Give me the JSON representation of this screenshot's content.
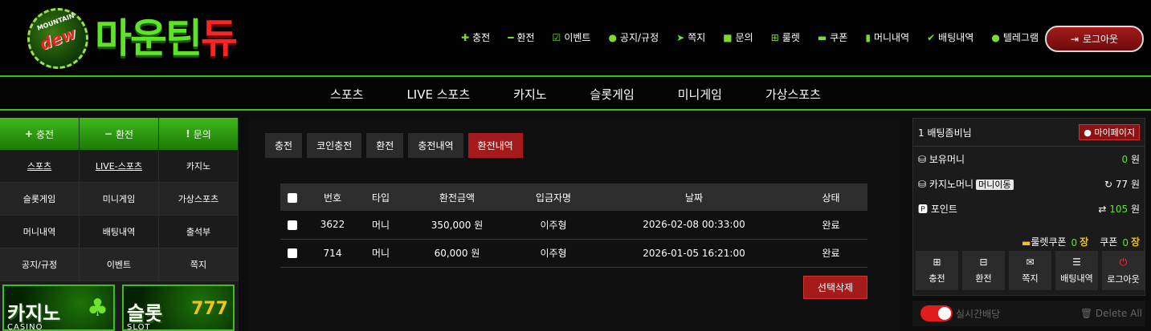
{
  "brand": {
    "logo_text": "마운틴",
    "logo_text_red": "듀",
    "cap_top": "MOUNTAIN",
    "cap_main": "dew"
  },
  "topnav": [
    {
      "icon": "plus",
      "label": "충전"
    },
    {
      "icon": "minus",
      "label": "환전"
    },
    {
      "icon": "calendar-check",
      "label": "이벤트"
    },
    {
      "icon": "info-circle",
      "label": "공지/규정"
    },
    {
      "icon": "paper-plane",
      "label": "쪽지"
    },
    {
      "icon": "edit",
      "label": "문의"
    },
    {
      "icon": "gift",
      "label": "룰렛"
    },
    {
      "icon": "ticket",
      "label": "쿠폰"
    },
    {
      "icon": "clipboard",
      "label": "머니내역"
    },
    {
      "icon": "check",
      "label": "배팅내역"
    },
    {
      "icon": "telegram",
      "label": "텔레그램"
    }
  ],
  "logout_label": "로그아웃",
  "mainnav": [
    "스포츠",
    "LIVE 스포츠",
    "카지노",
    "슬롯게임",
    "미니게임",
    "가상스포츠"
  ],
  "left": {
    "quick": [
      {
        "icon": "+",
        "label": "충전"
      },
      {
        "icon": "−",
        "label": "환전"
      },
      {
        "icon": "!",
        "label": "문의"
      }
    ],
    "grid": [
      "스포츠",
      "LIVE-스포츠",
      "카지노",
      "슬롯게임",
      "미니게임",
      "가상스포츠",
      "머니내역",
      "배팅내역",
      "출석부",
      "공지/규정",
      "이벤트",
      "쪽지"
    ],
    "banners": [
      {
        "title": "카지노",
        "sub": "CASINO"
      },
      {
        "title": "슬롯",
        "sub": "SLOT"
      }
    ]
  },
  "tabs": [
    {
      "label": "충전",
      "active": false
    },
    {
      "label": "코인충전",
      "active": false
    },
    {
      "label": "환전",
      "active": false
    },
    {
      "label": "충전내역",
      "active": false
    },
    {
      "label": "환전내역",
      "active": true
    }
  ],
  "table": {
    "headers": [
      "번호",
      "타입",
      "환전금액",
      "입금자명",
      "날짜",
      "상태"
    ],
    "rows": [
      {
        "no": "3622",
        "type": "머니",
        "amount": "350,000 원",
        "name": "이주형",
        "date": "2026-02-08 00:33:00",
        "status": "완료"
      },
      {
        "no": "714",
        "type": "머니",
        "amount": "60,000 원",
        "name": "이주형",
        "date": "2026-01-05 16:21:00",
        "status": "완료"
      }
    ]
  },
  "delete_selected": "선택삭제",
  "right": {
    "user": "1 배팅좀비님",
    "mypage": "마이페이지",
    "holding_label": "보유머니",
    "holding_value": "0",
    "casino_label": "카지노머니",
    "money_move": "머니이동",
    "casino_value": "77",
    "point_label": "포인트",
    "point_value": "105",
    "won": "원",
    "roulette_label": "룰렛쿠폰",
    "roulette_value": "0",
    "coupon_label": "쿠폰",
    "coupon_value": "0",
    "unit": "장",
    "buttons": [
      {
        "icon": "plus-square",
        "label": "충전"
      },
      {
        "icon": "minus-square",
        "label": "환전"
      },
      {
        "icon": "envelope",
        "label": "쪽지"
      },
      {
        "icon": "list",
        "label": "배팅내역"
      },
      {
        "icon": "power",
        "label": "로그아웃"
      }
    ]
  },
  "live": {
    "label": "실시간배당",
    "delete_all": "Delete All"
  },
  "colors": {
    "accent_green": "#3fbf1c",
    "accent_red": "#a51a1a",
    "text_green": "#5fe22a",
    "text_yellow": "#f2c21a"
  }
}
